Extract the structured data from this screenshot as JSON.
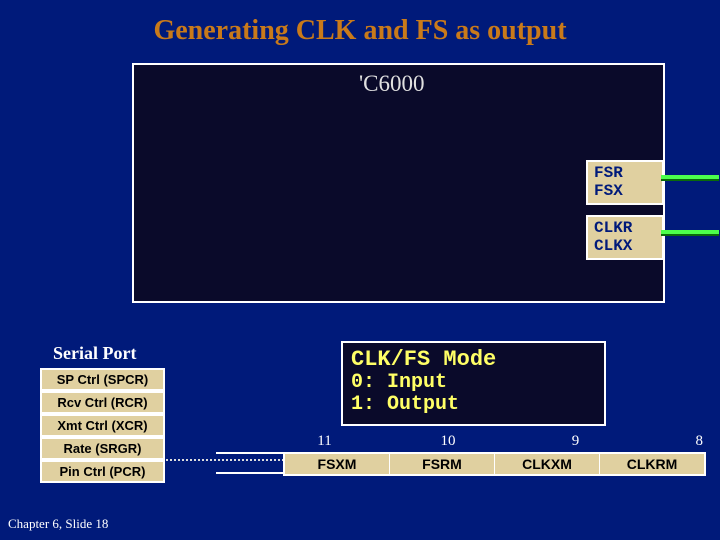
{
  "title": "Generating CLK and FS as output",
  "device": {
    "label": "'C6000",
    "pins": {
      "fs_line1": "FSR",
      "fs_line2": "FSX",
      "clk_line1": "CLKR",
      "clk_line2": "CLKX"
    }
  },
  "panel": {
    "title": "Serial Port",
    "items": [
      "SP Ctrl (SPCR)",
      "Rcv Ctrl (RCR)",
      "Xmt Ctrl (XCR)",
      "Rate (SRGR)",
      "Pin Ctrl (PCR)"
    ]
  },
  "modebox": {
    "title": "CLK/FS Mode",
    "line0": "0: Input",
    "line1": "1: Output"
  },
  "bits": {
    "nums": [
      "11",
      "10",
      "9",
      "8"
    ],
    "names": [
      "FSXM",
      "FSRM",
      "CLKXM",
      "CLKRM"
    ]
  },
  "footer": "Chapter 6, Slide 18"
}
